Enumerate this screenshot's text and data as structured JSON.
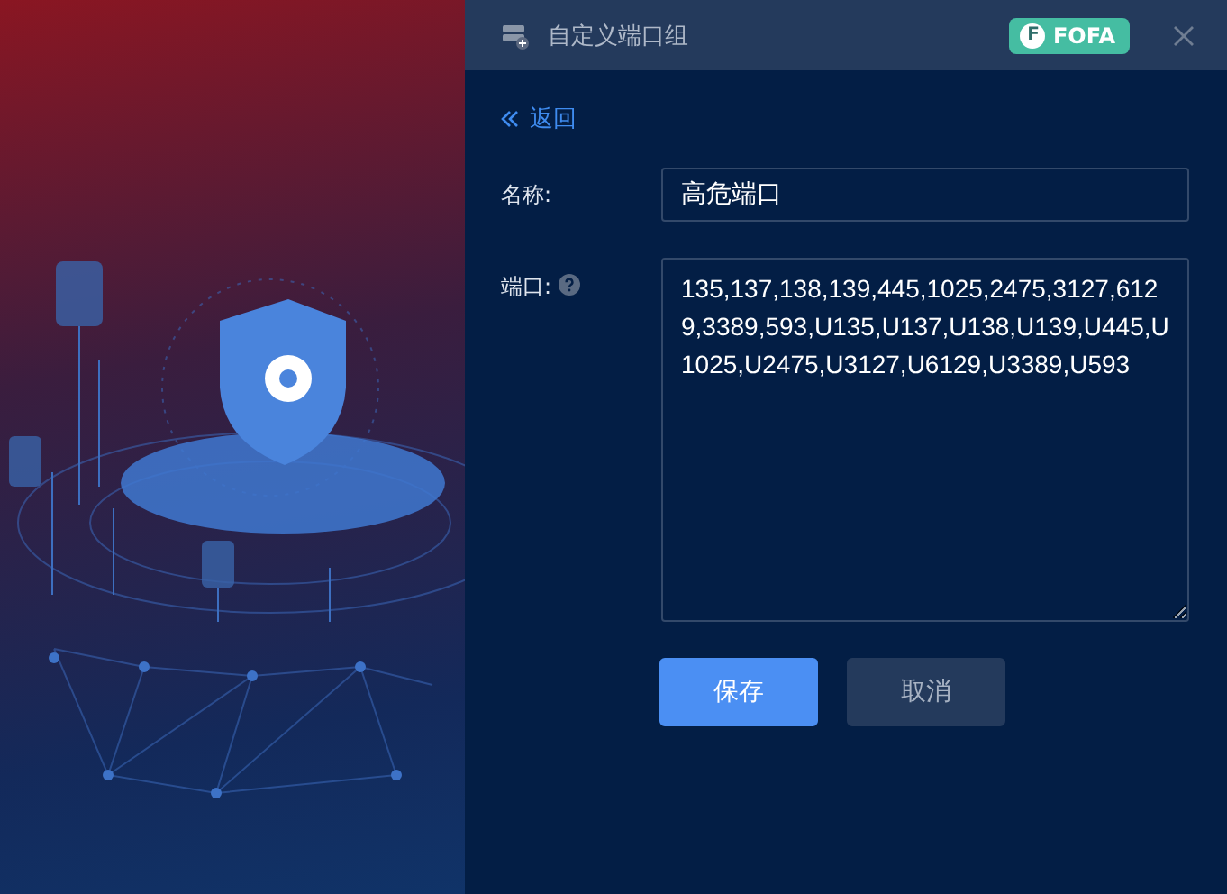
{
  "panel": {
    "title": "自定义端口组",
    "badge": "FOFA",
    "badge_letter": "F"
  },
  "back_link": "返回",
  "form": {
    "fields": [
      {
        "kind": "input",
        "label": "名称:",
        "value": "高危端口",
        "help": false
      },
      {
        "kind": "textarea",
        "label": "端口:",
        "value": "135,137,138,139,445,1025,2475,3127,6129,3389,593,U135,U137,U138,U139,U445,U1025,U2475,U3127,U6129,U3389,U593",
        "help": true
      }
    ]
  },
  "buttons": [
    {
      "label": "保存",
      "kind": "primary"
    },
    {
      "label": "取消",
      "kind": "secondary"
    }
  ]
}
